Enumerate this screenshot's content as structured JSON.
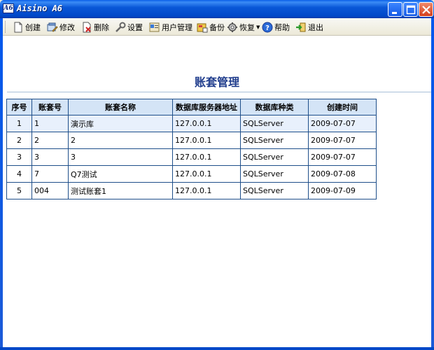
{
  "window": {
    "logo_text": "A6",
    "title": "Aisino A6"
  },
  "toolbar": {
    "items": [
      {
        "label": "创建",
        "icon": "new-document-icon"
      },
      {
        "label": "修改",
        "icon": "edit-icon"
      },
      {
        "label": "删除",
        "icon": "delete-icon"
      },
      {
        "label": "设置",
        "icon": "wrench-icon"
      },
      {
        "label": "用户管理",
        "icon": "user-management-icon"
      },
      {
        "label": "备份",
        "icon": "backup-icon"
      },
      {
        "label": "恢复",
        "icon": "restore-gear-icon"
      },
      {
        "label": "帮助",
        "icon": "help-icon"
      },
      {
        "label": "退出",
        "icon": "exit-icon"
      }
    ]
  },
  "page": {
    "title": "账套管理"
  },
  "table": {
    "columns": [
      "序号",
      "账套号",
      "账套名称",
      "数据库服务器地址",
      "数据库种类",
      "创建时间"
    ],
    "rows": [
      [
        "1",
        "1",
        "演示库",
        "127.0.0.1",
        "SQLServer",
        "2009-07-07"
      ],
      [
        "2",
        "2",
        "2",
        "127.0.0.1",
        "SQLServer",
        "2009-07-07"
      ],
      [
        "3",
        "3",
        "3",
        "127.0.0.1",
        "SQLServer",
        "2009-07-07"
      ],
      [
        "4",
        "7",
        "Q7测试",
        "127.0.0.1",
        "SQLServer",
        "2009-07-08"
      ],
      [
        "5",
        "004",
        "测试账套1",
        "127.0.0.1",
        "SQLServer",
        "2009-07-09"
      ]
    ]
  },
  "colors": {
    "title_bar": "#0a58d8",
    "header_bg": "#d4e4f6",
    "heading_text": "#1f3c8c",
    "grid_border": "#1f4f8a"
  }
}
